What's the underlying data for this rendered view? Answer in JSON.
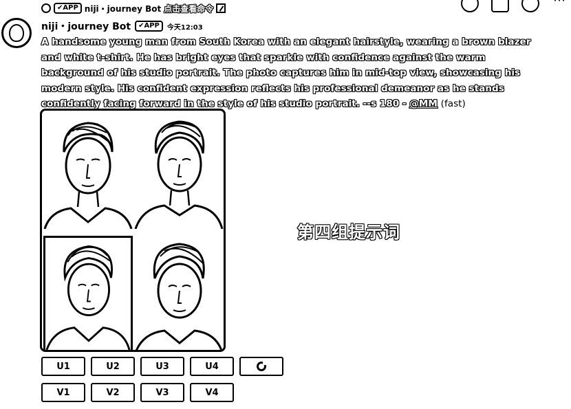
{
  "reply": {
    "app_badge": "✔APP",
    "bot_name": "niji・journey Bot",
    "command_link": "点击查看命令"
  },
  "message": {
    "author": "niji・journey Bot",
    "app_badge": "✔APP",
    "timestamp": "今天12:03",
    "prompt": "A handsome young man from South Korea with an elegant hairstyle, wearing a brown blazer and white t-shirt. He has bright eyes that sparkle with confidence against the warm background of his studio portrait. The photo captures him in mid-top view, showcasing his modern style. His confident expression reflects his professional demeanor as he stands confidently facing forward in the style of his studio portrait. --s 180 -",
    "mention": "@MM",
    "speed": "(fast)"
  },
  "buttons": {
    "upscale": [
      "U1",
      "U2",
      "U3",
      "U4"
    ],
    "variation": [
      "V1",
      "V2",
      "V3",
      "V4"
    ],
    "reroll_icon": "refresh-icon"
  },
  "caption": "第四组提示词",
  "icons": {
    "avatar": "egg-avatar-icon",
    "top_right": [
      "circle-icon",
      "pin-icon",
      "members-icon",
      "more-icon"
    ]
  }
}
